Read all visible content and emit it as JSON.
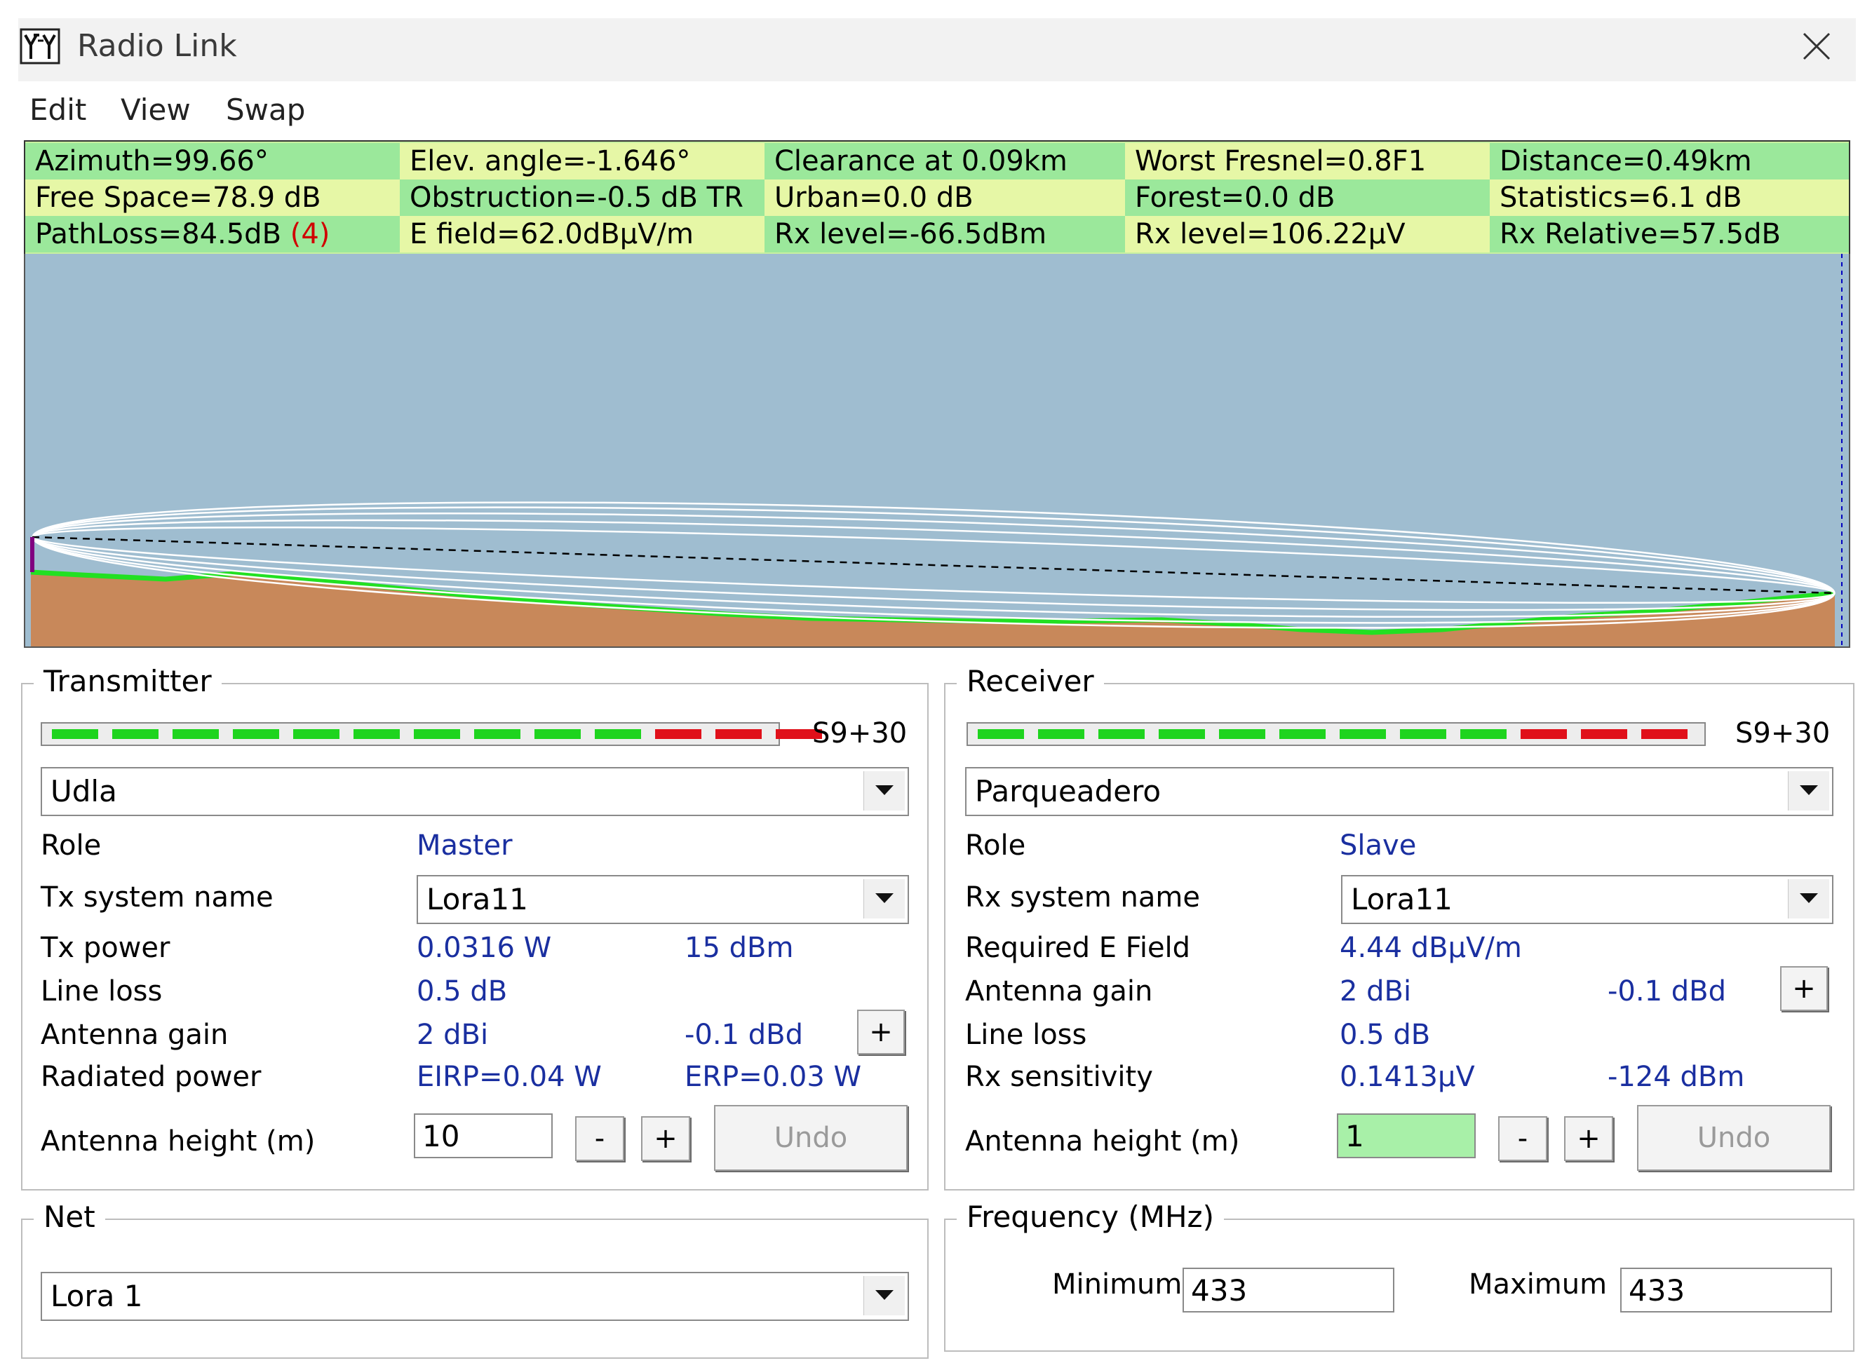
{
  "window": {
    "title": "Radio Link",
    "close_glyph": "✕",
    "app_icon": "antenna-grid-icon"
  },
  "menu": [
    {
      "label": "Edit"
    },
    {
      "label": "View"
    },
    {
      "label": "Swap"
    }
  ],
  "info": {
    "row1": [
      "Azimuth=99.66°",
      "Elev. angle=-1.646°",
      "Clearance at 0.09km",
      "Worst Fresnel=0.8F1",
      "Distance=0.49km"
    ],
    "row2": [
      "Free Space=78.9 dB",
      "Obstruction=-0.5 dB TR",
      "Urban=0.0 dB",
      "Forest=0.0 dB",
      "Statistics=6.1 dB"
    ],
    "row3_pathloss": "PathLoss=84.5dB",
    "row3_pathloss_flag": "(4)",
    "row3": [
      "E field=62.0dBµV/m",
      "Rx level=-66.5dBm",
      "Rx level=106.22µV",
      "Rx Relative=57.5dB"
    ]
  },
  "profile": {
    "colors": {
      "sky": "#9fbdd0",
      "terrain": "#c8885a",
      "terrain_edge": "#22e022",
      "fresnel": "#ffffff",
      "line_of_sight": "#000000",
      "tx_antenna": "#800080",
      "rx_marker": "#0000c0"
    }
  },
  "transmitter": {
    "group_label": "Transmitter",
    "s_meter": "S9+30",
    "meter_green_segments": 10,
    "meter_red_segments": 3,
    "station": "Udla",
    "role_label": "Role",
    "role_value": "Master",
    "system_label": "Tx system name",
    "system_value": "Lora11",
    "power_label": "Tx power",
    "power_w": "0.0316 W",
    "power_dbm": "15 dBm",
    "lineloss_label": "Line loss",
    "lineloss_value": "0.5 dB",
    "gain_label": "Antenna gain",
    "gain_dbi": "2 dBi",
    "gain_dbd": "-0.1 dBd",
    "gain_plus": "+",
    "radiated_label": "Radiated power",
    "eirp": "EIRP=0.04 W",
    "erp": "ERP=0.03 W",
    "height_label": "Antenna height (m)",
    "height_value": "10",
    "minus": "-",
    "plus": "+",
    "undo": "Undo"
  },
  "receiver": {
    "group_label": "Receiver",
    "s_meter": "S9+30",
    "meter_green_segments": 9,
    "meter_red_segments": 3,
    "station": "Parqueadero",
    "role_label": "Role",
    "role_value": "Slave",
    "system_label": "Rx system name",
    "system_value": "Lora11",
    "efield_label": "Required E Field",
    "efield_value": "4.44 dBµV/m",
    "gain_label": "Antenna gain",
    "gain_dbi": "2 dBi",
    "gain_dbd": "-0.1 dBd",
    "gain_plus": "+",
    "lineloss_label": "Line loss",
    "lineloss_value": "0.5 dB",
    "sens_label": "Rx sensitivity",
    "sens_uv": "0.1413µV",
    "sens_dbm": "-124 dBm",
    "height_label": "Antenna height (m)",
    "height_value": "1",
    "minus": "-",
    "plus": "+",
    "undo": "Undo"
  },
  "net": {
    "group_label": "Net",
    "value": "Lora 1"
  },
  "frequency": {
    "group_label": "Frequency (MHz)",
    "min_label": "Minimum",
    "min_value": "433",
    "max_label": "Maximum",
    "max_value": "433"
  }
}
